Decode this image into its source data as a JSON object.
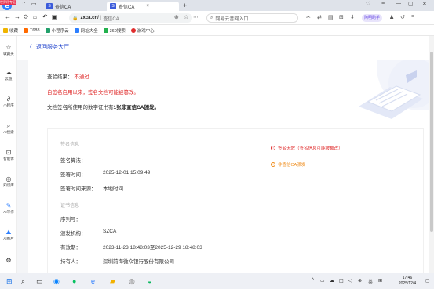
{
  "browser": {
    "brand_tag": "世界杯专区",
    "tabs": [
      {
        "label": "查信CA",
        "active": false
      },
      {
        "label": "查信CA",
        "active": true
      }
    ],
    "url_host": "zxca.cn/",
    "url_title": "查信CA",
    "search_placeholder": "网易云音网入口",
    "ai_badge": "阿明助手"
  },
  "bookmarks": [
    {
      "label": "收藏",
      "color": "#f0b400"
    },
    {
      "label": "T688",
      "color": "#ff6a00"
    },
    {
      "label": "小程序云",
      "color": "#22a06b"
    },
    {
      "label": "网址大全",
      "color": "#2d7fff"
    },
    {
      "label": "360搜索",
      "color": "#23b14d"
    },
    {
      "label": "游戏中心",
      "color": "#e02d2d"
    }
  ],
  "sidebar": [
    {
      "icon": "star-icon",
      "glyph": "☆",
      "label": "收藏夹"
    },
    {
      "icon": "cloud-icon",
      "glyph": "☁",
      "label": "云盘"
    },
    {
      "icon": "mini-program-icon",
      "glyph": "∂",
      "label": "小程序"
    },
    {
      "icon": "search-icon",
      "glyph": "⌕",
      "label": "AI搜索"
    },
    {
      "icon": "translate-icon",
      "glyph": "⊡",
      "label": "智能体"
    },
    {
      "icon": "knowledge-icon",
      "glyph": "◎",
      "label": "知识库"
    },
    {
      "icon": "ai-write-icon",
      "glyph": "✎",
      "label": "AI写作"
    },
    {
      "icon": "ai-image-icon",
      "glyph": "⛰",
      "label": "AI图片"
    },
    {
      "icon": "more-icon",
      "glyph": "⚙",
      "label": ""
    }
  ],
  "page": {
    "back_label": "返回服务大厅",
    "result_label": "查验结果：",
    "result_value": "不通过",
    "warning_text": "自签名启用以来，签名文档可能被篡改。",
    "cert_text_prefix": "文档签名所使用的数字证书有",
    "cert_text_bold": "1张非查信CA颁发。",
    "signature_section": "签名信息",
    "signature_rows": [
      {
        "key": "签名算法：",
        "value": ""
      },
      {
        "key": "签署时间：",
        "value": "2025-12-01 15:09:49"
      },
      {
        "key": "签署时间来源：",
        "value": "本地时间"
      }
    ],
    "cert_section": "证书信息",
    "cert_rows": [
      {
        "key": "序列号：",
        "value": ""
      },
      {
        "key": "颁发机构：",
        "value": "SZCA"
      },
      {
        "key": "有效期：",
        "value": "2023-11-23 18:48:03至2025-12-29 18:48:03"
      },
      {
        "key": "持有人：",
        "value": "深圳前海微众银行股份有限公司"
      }
    ],
    "warn_invalid": "签名无效（签名信息可能被篡改）",
    "warn_non_ca": "非查信CA颁发"
  },
  "taskbar": {
    "ime": "英",
    "time": "17:46",
    "date": "2025/12/4"
  },
  "colors": {
    "accent": "#2d4ecf",
    "error": "#e02d2d",
    "warning": "#ef8a17"
  }
}
